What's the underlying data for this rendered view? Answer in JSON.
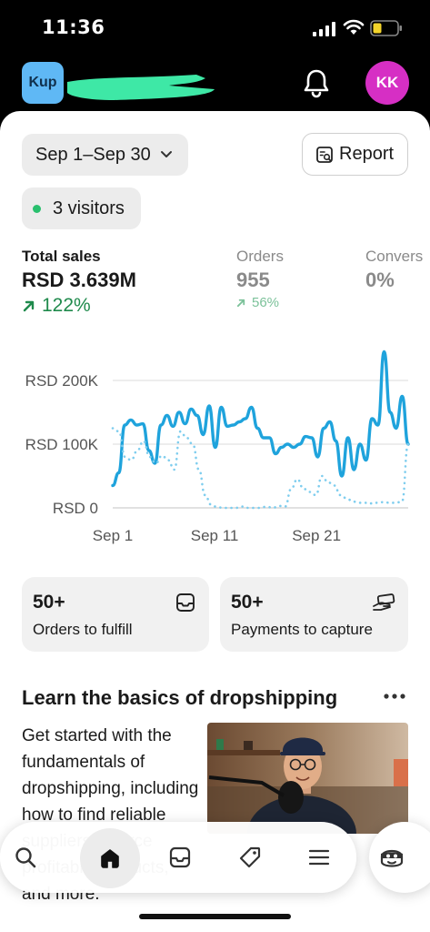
{
  "status_bar": {
    "time": "11:36"
  },
  "header": {
    "store_badge": "Kup",
    "avatar_initials": "KK"
  },
  "filters": {
    "date_range": "Sep 1–Sep 30",
    "report_label": "Report",
    "visitors": "3 visitors"
  },
  "metrics": {
    "total_sales": {
      "label": "Total sales",
      "value": "RSD 3.639M",
      "change": "122%"
    },
    "orders": {
      "label": "Orders",
      "value": "955",
      "change": "56%"
    },
    "conversion": {
      "label": "Convers",
      "value": "0%"
    }
  },
  "chart_data": {
    "type": "line",
    "ylim": [
      0,
      200000
    ],
    "y_ticks": [
      "RSD 0",
      "RSD 100K",
      "RSD 200K"
    ],
    "x_ticks": [
      "Sep 1",
      "Sep 11",
      "Sep 21"
    ],
    "grid": true,
    "colors": {
      "current": "#1fa3dc",
      "previous": "#7ecdee"
    },
    "series": [
      {
        "style": "solid",
        "values": [
          35000,
          55000,
          130000,
          138000,
          130000,
          132000,
          90000,
          70000,
          130000,
          145000,
          128000,
          150000,
          132000,
          155000,
          145000,
          115000,
          160000,
          95000,
          158000,
          128000,
          130000,
          135000,
          140000,
          158000,
          125000,
          110000,
          110000,
          85000,
          95000,
          100000,
          95000,
          100000,
          112000,
          110000,
          80000,
          125000,
          135000,
          105000,
          50000,
          110000,
          60000,
          100000,
          75000,
          140000,
          130000,
          245000,
          150000,
          125000,
          175000,
          100000
        ]
      },
      {
        "style": "dotted",
        "values": [
          125000,
          120000,
          80000,
          75000,
          90000,
          105000,
          80000,
          70000,
          82000,
          75000,
          60000,
          120000,
          110000,
          100000,
          60000,
          20000,
          5000,
          1000,
          0,
          0,
          0,
          2000,
          0,
          0,
          0,
          2000,
          0,
          3000,
          2000,
          30000,
          45000,
          30000,
          25000,
          20000,
          50000,
          40000,
          35000,
          20000,
          15000,
          10000,
          8000,
          8000,
          7000,
          8000,
          9000,
          8000,
          8000,
          10000,
          100000
        ]
      }
    ]
  },
  "tasks": {
    "orders": {
      "count": "50+",
      "label": "Orders to fulfill"
    },
    "payments": {
      "count": "50+",
      "label": "Payments to capture"
    }
  },
  "learn": {
    "title": "Learn the basics of dropshipping",
    "body": "Get started with the fundamentals of dropshipping, including how to find reliable suppliers, source profitable products, and more."
  },
  "bottom_nav": {
    "items": [
      "search-icon",
      "home-icon",
      "inbox-icon",
      "tag-icon",
      "menu-icon"
    ],
    "sidekick": "sidekick-icon"
  }
}
